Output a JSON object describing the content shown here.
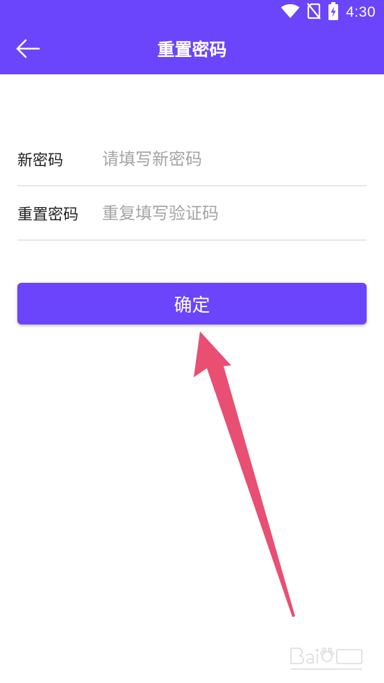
{
  "status_bar": {
    "time": "4:30",
    "icons": [
      "wifi-icon",
      "no-sim-icon",
      "battery-charging-icon"
    ]
  },
  "header": {
    "title": "重置密码",
    "back_icon": "arrow-left-icon"
  },
  "form": {
    "new_password": {
      "label": "新密码",
      "value": "",
      "placeholder": "请填写新密码"
    },
    "reset_password": {
      "label": "重置密码",
      "value": "",
      "placeholder": "重复填写验证码"
    }
  },
  "confirm_button": {
    "label": "确定"
  },
  "colors": {
    "primary": "#6a45fb",
    "annotation_arrow": "#e84f72"
  }
}
